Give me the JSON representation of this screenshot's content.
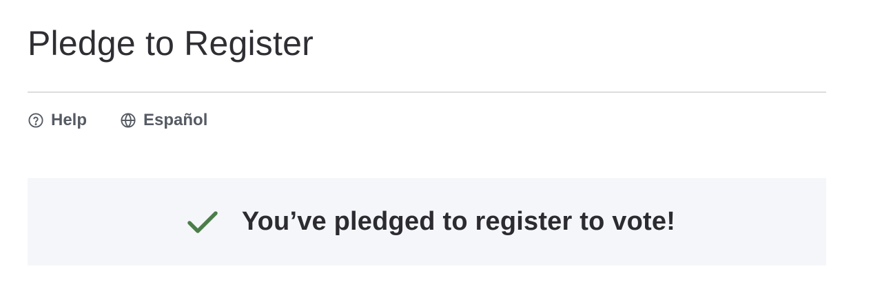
{
  "header": {
    "title": "Pledge to Register"
  },
  "utility_nav": {
    "help": {
      "label": "Help",
      "icon": "help-circle-icon"
    },
    "language": {
      "label": "Español",
      "icon": "globe-icon"
    }
  },
  "confirmation": {
    "icon": "checkmark-icon",
    "message": "You’ve pledged to register to vote!"
  },
  "colors": {
    "check": "#4b7d4a",
    "banner_background": "#f5f6f9",
    "divider": "#dcdcdc",
    "nav_text": "#555a63"
  }
}
